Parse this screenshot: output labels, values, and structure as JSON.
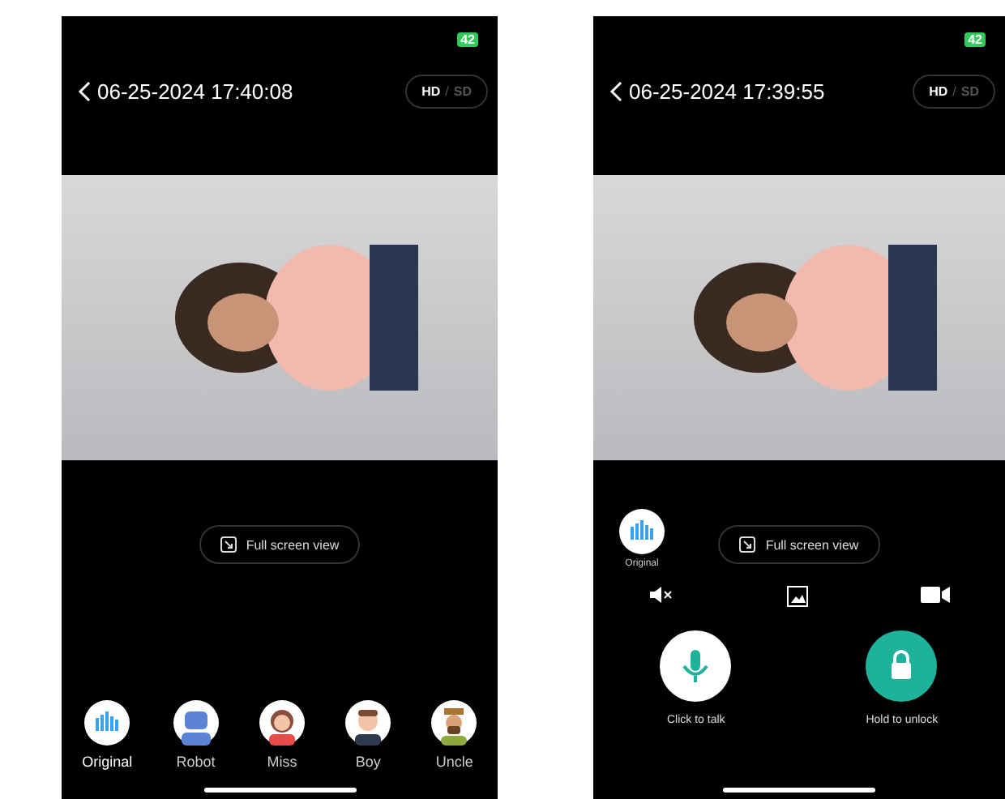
{
  "screens": [
    {
      "kind": "voice-changer",
      "battery": "42",
      "title": "06-25-2024 17:40:08",
      "quality": [
        {
          "label": "HD",
          "selected": true
        },
        {
          "label": "SD",
          "selected": false
        }
      ],
      "quality_separator": "/",
      "fullscreen": "Full screen view",
      "voices": [
        {
          "label": "Original",
          "kind": "original",
          "selected": true
        },
        {
          "label": "Robot",
          "kind": "robot",
          "selected": false
        },
        {
          "label": "Miss",
          "kind": "miss",
          "selected": false
        },
        {
          "label": "Boy",
          "kind": "boy",
          "selected": false
        },
        {
          "label": "Uncle",
          "kind": "uncle",
          "selected": false
        }
      ]
    },
    {
      "kind": "intercom",
      "battery": "42",
      "title": "06-25-2024 17:39:55",
      "quality": [
        {
          "label": "HD",
          "selected": true
        },
        {
          "label": "SD",
          "selected": false
        }
      ],
      "quality_separator": "/",
      "fullscreen": "Full screen view",
      "voice": {
        "label": "Original"
      },
      "muted": true,
      "actions": [
        {
          "label": "Click to talk",
          "kind": "talk"
        },
        {
          "label": "Hold to unlock",
          "kind": "unlock"
        }
      ]
    }
  ]
}
